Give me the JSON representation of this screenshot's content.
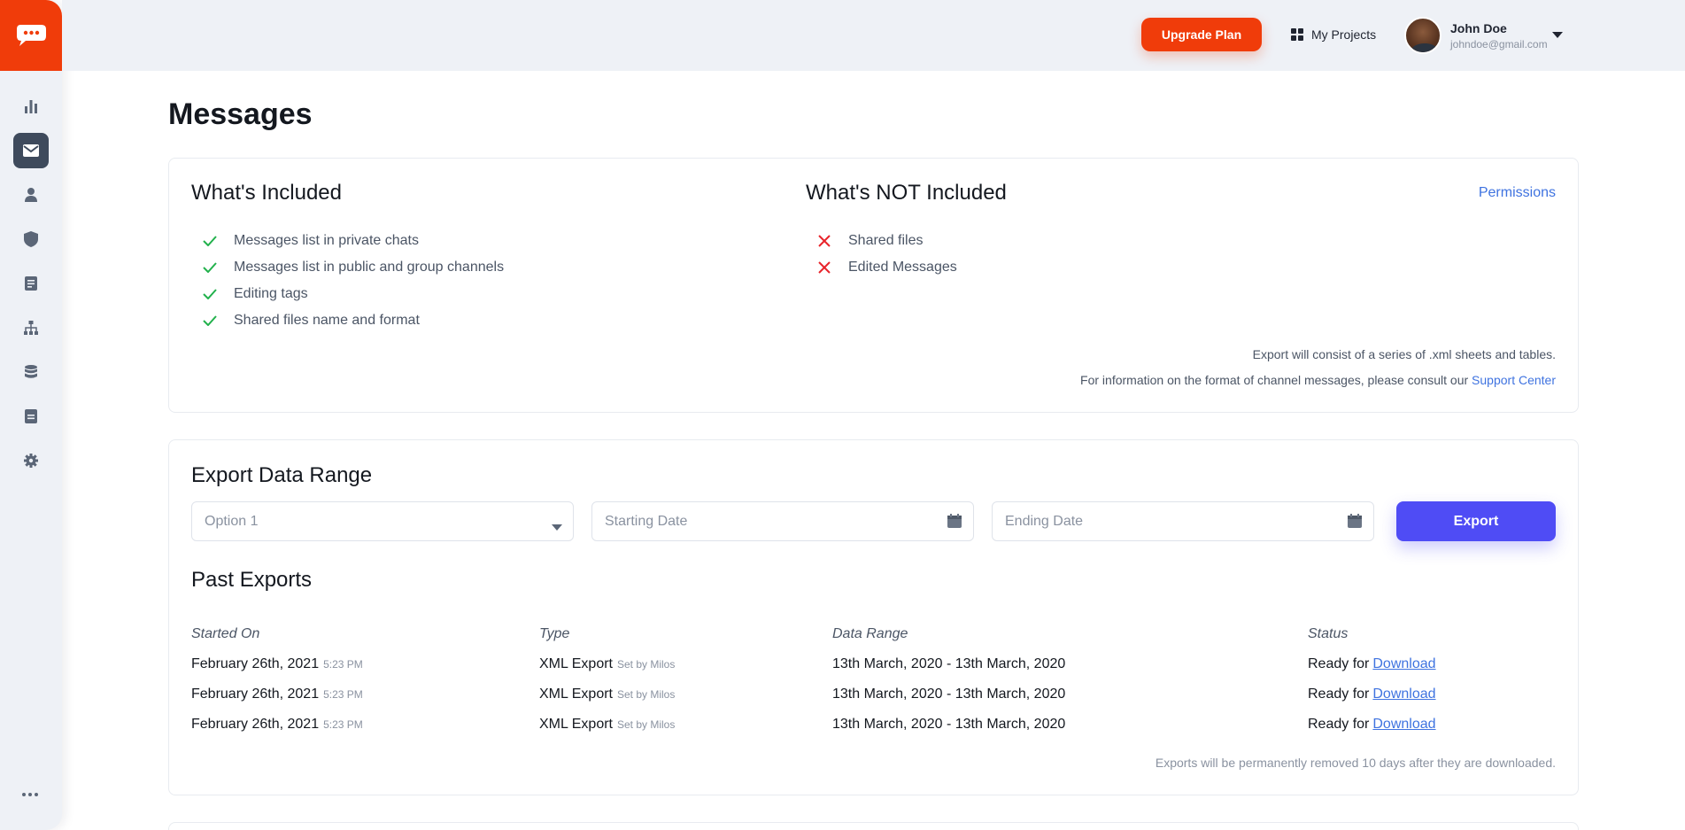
{
  "header": {
    "upgrade_label": "Upgrade Plan",
    "projects_label": "My Projects",
    "user_name": "John Doe",
    "user_email": "johndoe@gmail.com"
  },
  "sidebar": {
    "items": [
      {
        "name": "analytics",
        "icon": "bar-chart-icon"
      },
      {
        "name": "messages",
        "icon": "envelope-icon",
        "active": true
      },
      {
        "name": "users",
        "icon": "user-icon"
      },
      {
        "name": "security",
        "icon": "shield-icon"
      },
      {
        "name": "documents",
        "icon": "document-icon"
      },
      {
        "name": "structure",
        "icon": "sitemap-icon"
      },
      {
        "name": "database",
        "icon": "database-icon"
      },
      {
        "name": "reports",
        "icon": "note-icon"
      },
      {
        "name": "settings",
        "icon": "gear-icon"
      }
    ]
  },
  "page": {
    "title": "Messages"
  },
  "included": {
    "title": "What's Included",
    "items": [
      "Messages list in private chats",
      "Messages list in public and group channels",
      "Editing tags",
      "Shared files name and format"
    ]
  },
  "not_included": {
    "title": "What's NOT Included",
    "items": [
      "Shared files",
      "Edited Messages"
    ],
    "permissions_link": "Permissions"
  },
  "notes": {
    "line1": "Export will consist of a series of .xml sheets and tables.",
    "line2_prefix": "For information on the format of channel messages, please consult our ",
    "line2_link": "Support Center"
  },
  "export_range": {
    "title": "Export Data Range",
    "option_value": "Option 1",
    "starting_placeholder": "Starting Date",
    "ending_placeholder": "Ending Date",
    "export_label": "Export"
  },
  "past_exports": {
    "title": "Past Exports",
    "headers": [
      "Started On",
      "Type",
      "Data Range",
      "Status"
    ],
    "rows": [
      {
        "date": "February 26th, 2021",
        "time": "5:23 PM",
        "type": "XML Export",
        "set_by": "Set by Milos",
        "range": "13th March, 2020 - 13th March, 2020",
        "status": "Ready for",
        "link": "Download"
      },
      {
        "date": "February 26th, 2021",
        "time": "5:23 PM",
        "type": "XML Export",
        "set_by": "Set by Milos",
        "range": "13th March, 2020 - 13th March, 2020",
        "status": "Ready for",
        "link": "Download"
      },
      {
        "date": "February 26th, 2021",
        "time": "5:23 PM",
        "type": "XML Export",
        "set_by": "Set by Milos",
        "range": "13th March, 2020 - 13th March, 2020",
        "status": "Ready for",
        "link": "Download"
      }
    ],
    "footnote": "Exports will be permanently removed 10 days after they are downloaded."
  },
  "colors": {
    "brand": "#f03c0a",
    "primary": "#4f4cf5",
    "link": "#3f73e0",
    "check": "#22b14c",
    "cross": "#e8242b"
  }
}
